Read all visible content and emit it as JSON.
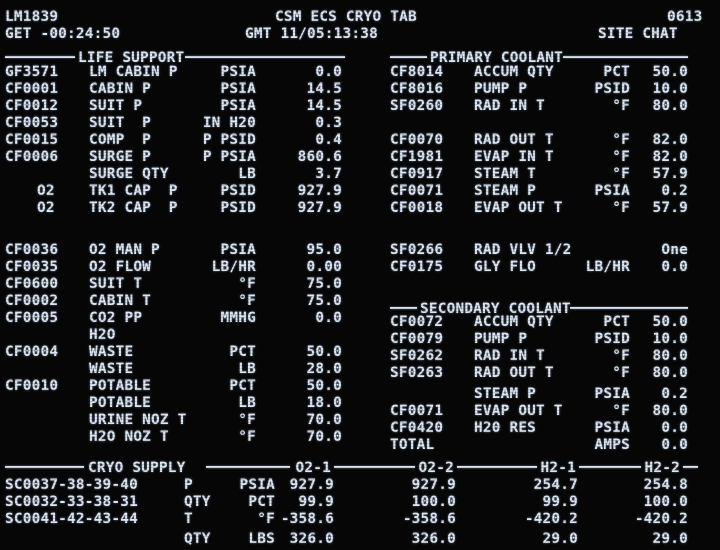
{
  "header": {
    "id": "LM1839",
    "title": "CSM ECS CRYO TAB",
    "code": "0613",
    "get": "GET -00:24:50",
    "gmt": "GMT 11/05:13:38",
    "site": "SITE CHAT"
  },
  "sections": {
    "life_support": "LIFE SUPPORT",
    "primary_coolant": "PRIMARY COOLANT",
    "secondary_coolant": "SECONDARY COOLANT",
    "cryo_supply": "CRYO SUPPLY"
  },
  "life_support": [
    {
      "id": "GF3571",
      "label": "LM CABIN P",
      "unit": "PSIA",
      "value": "0.0"
    },
    {
      "id": "CF0001",
      "label": "CABIN P",
      "unit": "PSIA",
      "value": "14.5"
    },
    {
      "id": "CF0012",
      "label": "SUIT P",
      "unit": "PSIA",
      "value": "14.5"
    },
    {
      "id": "CF0053",
      "label": "SUIT  P",
      "unit": "IN H20",
      "value": "0.3"
    },
    {
      "id": "CF0015",
      "label": "COMP  P",
      "unit": "P PSID",
      "value": "0.4"
    },
    {
      "id": "CF0006",
      "label": "SURGE P",
      "unit": "P PSIA",
      "value": "860.6"
    },
    {
      "id": "",
      "label": "SURGE QTY",
      "unit": "LB",
      "value": "3.7"
    },
    {
      "id": "O2",
      "label": "TK1 CAP  P",
      "unit": "PSID",
      "value": "927.9"
    },
    {
      "id": "O2",
      "label": "TK2 CAP  P",
      "unit": "PSID",
      "value": "927.9"
    },
    {
      "id": "CF0036",
      "label": "O2 MAN P",
      "unit": "PSIA",
      "value": "95.0"
    },
    {
      "id": "CF0035",
      "label": "O2 FLOW",
      "unit": "LB/HR",
      "value": "0.00"
    },
    {
      "id": "CF0600",
      "label": "SUIT T",
      "unit": "°F",
      "value": "75.0"
    },
    {
      "id": "CF0002",
      "label": "CABIN T",
      "unit": "°F",
      "value": "75.0"
    },
    {
      "id": "CF0005",
      "label": "CO2 PP",
      "unit": "MMHG",
      "value": "0.0"
    },
    {
      "id": "",
      "label": "H2O",
      "unit": "",
      "value": ""
    },
    {
      "id": "CF0004",
      "label": "WASTE",
      "unit": "PCT",
      "value": "50.0"
    },
    {
      "id": "",
      "label": "WASTE",
      "unit": "LB",
      "value": "28.0"
    },
    {
      "id": "CF0010",
      "label": "POTABLE",
      "unit": "PCT",
      "value": "50.0"
    },
    {
      "id": "",
      "label": "POTABLE",
      "unit": "LB",
      "value": "18.0"
    },
    {
      "id": "",
      "label": "URINE NOZ T",
      "unit": "°F",
      "value": "70.0"
    },
    {
      "id": "",
      "label": "H2O NOZ T",
      "unit": "°F",
      "value": "70.0"
    }
  ],
  "primary": [
    {
      "id": "CF8014",
      "label": "ACCUM QTY",
      "unit": "PCT",
      "value": "50.0"
    },
    {
      "id": "CF8016",
      "label": "PUMP P",
      "unit": "PSID",
      "value": "10.0"
    },
    {
      "id": "SF0260",
      "label": "RAD IN T",
      "unit": "°F",
      "value": "80.0"
    },
    {
      "id": "CF0070",
      "label": "RAD OUT T",
      "unit": "°F",
      "value": "82.0"
    },
    {
      "id": "CF1981",
      "label": "EVAP IN T",
      "unit": "°F",
      "value": "82.0"
    },
    {
      "id": "CF0917",
      "label": "STEAM T",
      "unit": "°F",
      "value": "57.9"
    },
    {
      "id": "CF0071",
      "label": "STEAM P",
      "unit": "PSIA",
      "value": "0.2"
    },
    {
      "id": "CF0018",
      "label": "EVAP OUT T",
      "unit": "°F",
      "value": "57.9"
    },
    {
      "id": "SF0266",
      "label": "RAD VLV 1/2",
      "unit": "",
      "value": "One"
    },
    {
      "id": "CF0175",
      "label": "GLY FLO",
      "unit": "LB/HR",
      "value": "0.0"
    }
  ],
  "secondary": [
    {
      "id": "CF0072",
      "label": "ACCUM QTY",
      "unit": "PCT",
      "value": "50.0"
    },
    {
      "id": "CF0079",
      "label": "PUMP P",
      "unit": "PSID",
      "value": "10.0"
    },
    {
      "id": "SF0262",
      "label": "RAD IN T",
      "unit": "°F",
      "value": "80.0"
    },
    {
      "id": "SF0263",
      "label": "RAD OUT T",
      "unit": "°F",
      "value": "80.0"
    },
    {
      "id": "",
      "label": "STEAM P",
      "unit": "PSIA",
      "value": "0.2"
    },
    {
      "id": "CF0071",
      "label": "EVAP OUT T",
      "unit": "°F",
      "value": "80.0"
    },
    {
      "id": "CF0420",
      "label": "H20 RES",
      "unit": "PSIA",
      "value": "0.0"
    },
    {
      "id": "TOTAL",
      "label": "",
      "unit": "AMPS",
      "value": "0.0"
    }
  ],
  "cryo": {
    "columns": [
      "O2-1",
      "O2-2",
      "H2-1",
      "H2-2"
    ],
    "rows": [
      {
        "id": "SC0037-38-39-40",
        "param": "P",
        "unit": "PSIA",
        "values": [
          "927.9",
          "927.9",
          "254.7",
          "254.8"
        ]
      },
      {
        "id": "SC0032-33-38-31",
        "param": "QTY",
        "unit": "PCT",
        "values": [
          "99.9",
          "100.0",
          "99.9",
          "100.0"
        ]
      },
      {
        "id": "SC0041-42-43-44",
        "param": "T",
        "unit": "°F",
        "values": [
          "-358.6",
          "-358.6",
          "-420.2",
          "-420.2"
        ]
      },
      {
        "id": "",
        "param": "QTY",
        "unit": "LBS",
        "values": [
          "326.0",
          "326.0",
          "29.0",
          "29.0"
        ]
      }
    ]
  }
}
